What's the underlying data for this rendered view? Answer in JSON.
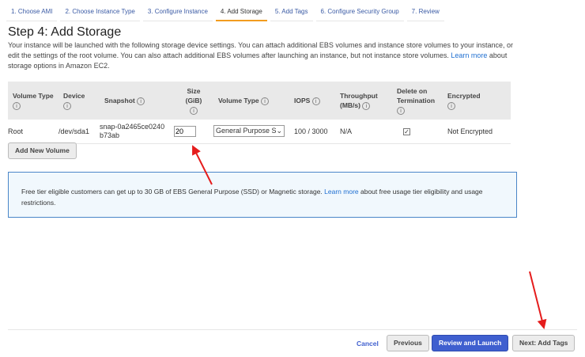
{
  "tabs": [
    "1. Choose AMI",
    "2. Choose Instance Type",
    "3. Configure Instance",
    "4. Add Storage",
    "5. Add Tags",
    "6. Configure Security Group",
    "7. Review"
  ],
  "title": "Step 4: Add Storage",
  "desc": {
    "text": "Your instance will be launched with the following storage device settings. You can attach additional EBS volumes and instance store volumes to your instance, or edit the settings of the root volume. You can also attach additional EBS volumes after launching an instance, but not instance store volumes. ",
    "link": "Learn more",
    "after": " about storage options in Amazon EC2."
  },
  "table": {
    "headers": [
      "Volume Type",
      "Device",
      "Snapshot",
      "Size (GiB)",
      "Volume Type",
      "IOPS",
      "Throughput (MB/s)",
      "Delete on Termination",
      "Encrypted"
    ],
    "row": {
      "type": "Root",
      "device": "/dev/sda1",
      "snapshot": "snap-0a2465ce0240b73ab",
      "size": "20",
      "volume_type": "General Purpose S",
      "iops": "100 / 3000",
      "throughput": "N/A",
      "delete_on_termination": true,
      "encrypted": "Not Encrypted"
    }
  },
  "add_volume": "Add New Volume",
  "info": {
    "text": "Free tier eligible customers can get up to 30 GB of EBS General Purpose (SSD) or Magnetic storage. ",
    "link": "Learn more",
    "after": " about free usage tier eligibility and usage restrictions."
  },
  "footer": {
    "cancel": "Cancel",
    "previous": "Previous",
    "review": "Review and Launch",
    "next": "Next: Add Tags"
  },
  "colors": {
    "accent": "#f29c1f",
    "primary": "#3f5fcf",
    "annotation": "#e51c1c"
  }
}
